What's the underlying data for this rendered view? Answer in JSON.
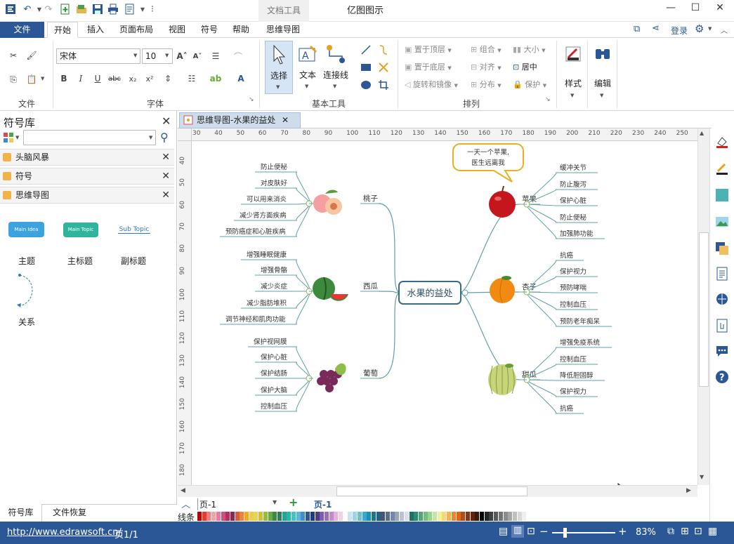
{
  "app": {
    "title": "亿图图示",
    "context_tab_label": "文档工具"
  },
  "menu": {
    "file": "文件",
    "tabs": [
      "开始",
      "插入",
      "页面布局",
      "视图",
      "符号",
      "帮助",
      "思维导图"
    ],
    "login": "登录"
  },
  "ribbon": {
    "groups": {
      "file": "文件",
      "font": "字体",
      "basic_tools": "基本工具",
      "arrange": "排列"
    },
    "font_name": "宋体",
    "font_size": "10",
    "tools": {
      "select": "选择",
      "text": "文本",
      "connector": "连接线"
    },
    "arrange": {
      "bring_front": "置于顶层",
      "send_back": "置于底层",
      "rotate": "旋转和镜像",
      "group": "组合",
      "align": "对齐",
      "distribute": "分布",
      "size": "大小",
      "center": "居中",
      "protect": "保护"
    },
    "style": "样式",
    "edit": "编辑"
  },
  "library": {
    "title": "符号库",
    "search_placeholder": "",
    "items": [
      "头脑风暴",
      "符号",
      "思维导图"
    ],
    "shapes": {
      "main_idea": "Main Idea",
      "main_topic": "Main Topic",
      "sub_topic": "Sub Topic",
      "topic_label": "主题",
      "main_topic_label": "主标题",
      "sub_topic_label": "副标题",
      "relation_label": "关系"
    },
    "bottom_tabs": [
      "符号库",
      "文件恢复"
    ]
  },
  "document": {
    "tab_title": "思维导图-水果的益处"
  },
  "ruler": {
    "top": [
      "30",
      "40",
      "50",
      "60",
      "70",
      "80",
      "90",
      "100",
      "110",
      "120",
      "130",
      "140",
      "150",
      "160",
      "170",
      "180",
      "190",
      "200",
      "210",
      "220",
      "230",
      "240",
      "250"
    ],
    "left": [
      "40",
      "50",
      "60",
      "70",
      "80",
      "90",
      "100",
      "110",
      "120",
      "130",
      "140",
      "150",
      "160",
      "170",
      "180"
    ]
  },
  "mindmap": {
    "center": "水果的益处",
    "callout_lines": [
      "一天一个苹果,",
      "医生远离我"
    ],
    "branches": {
      "peach": {
        "name": "桃子",
        "items": [
          "防止便秘",
          "对皮肤好",
          "可以用来消炎",
          "减少肾方面疾病",
          "预防癌症和心脏疾病"
        ]
      },
      "watermelon": {
        "name": "西瓜",
        "items": [
          "增强睡眠健康",
          "增强骨骼",
          "减少炎症",
          "减少脂肪堆积",
          "调节神经和肌肉功能"
        ]
      },
      "grape": {
        "name": "葡萄",
        "items": [
          "保护视网膜",
          "保护心脏",
          "保护结肠",
          "保护大脑",
          "控制血压"
        ]
      },
      "apple": {
        "name": "苹果",
        "items": [
          "缓冲关节",
          "防止腹泻",
          "保护心脏",
          "防止便秘",
          "加强肺功能"
        ]
      },
      "apricot": {
        "name": "杏子",
        "items": [
          "抗癌",
          "保护视力",
          "预防哮喘",
          "控制血压",
          "预防老年痴呆"
        ]
      },
      "melon": {
        "name": "甜瓜",
        "items": [
          "增强免疫系统",
          "控制血压",
          "降低胆固醇",
          "保护视力",
          "抗癌"
        ]
      }
    }
  },
  "pagebar": {
    "page_selector": "页-1",
    "active_page": "页-1",
    "line_label": "线条"
  },
  "status": {
    "url": "http://www.edrawsoft.cn/",
    "page_info": "页1/1",
    "zoom": "83%"
  },
  "colors": {
    "accent": "#2b5797",
    "branch_line": "#5fa0a8",
    "center_border": "#3a6b86"
  }
}
